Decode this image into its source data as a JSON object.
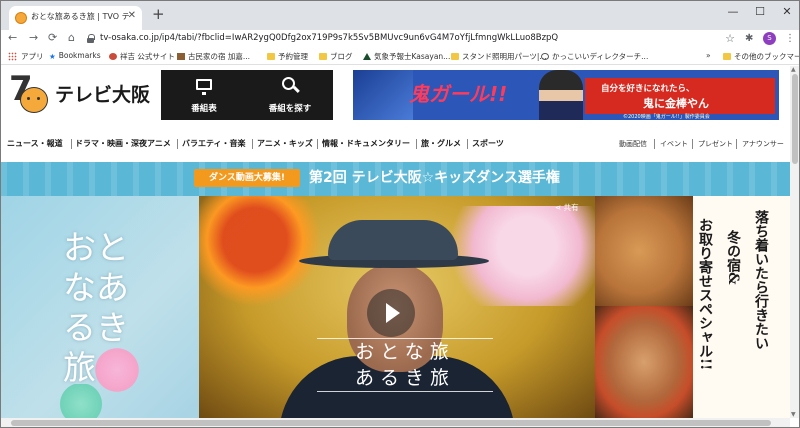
{
  "browser": {
    "tab_title": "おとな旅あるき旅 | TVO テレビ大阪",
    "new_tab": "+",
    "url": "tv-osaka.co.jp/ip4/tabi/?fbclid=IwAR2ygQ0Dfg2ox719P9s7k5Sv5BMUvc9un6vG4M7oYfjLfmngWkLLuo8BzpQ",
    "profile_initial": "S"
  },
  "bookmarks": {
    "items": [
      "アプリ",
      "Bookmarks",
      "祥吉 公式サイト",
      "古民家の宿 加嘉...",
      "予約管理",
      "ブログ",
      "気象予報士Kasayan...",
      "スタンド照明用パーツ|...",
      "かっこいいディレクターチ..."
    ],
    "more": "»",
    "other": "その他のブックマーク"
  },
  "site": {
    "logo_text": "テレビ大阪",
    "logo_mark": "7",
    "nav_boxes": [
      "番組表",
      "番組を探す"
    ],
    "banner": {
      "title": "鬼ガール!!",
      "copy1": "自分を好きになれたら、",
      "copy2": "鬼に金棒やん",
      "credit": "©2020映画「鬼ガール!!」製作委員会"
    },
    "genres": [
      "ニュース・報道",
      "ドラマ・映画・深夜アニメ",
      "バラエティ・音楽",
      "アニメ・キッズ",
      "情報・ドキュメンタリー",
      "旅・グルメ",
      "スポーツ"
    ],
    "util_links": [
      "動画配信",
      "イベント",
      "プレゼント",
      "アナウンサー"
    ],
    "dance": {
      "tag": "ダンス動画大募集!",
      "title": "第2回 テレビ大阪☆キッズダンス選手権"
    },
    "hero": {
      "left_title": "おとなあるき旅",
      "share": "共有",
      "video_line1": "おとな旅",
      "video_line2": "あるき旅",
      "promo_columns": [
        "お取り寄せスペシャル!!",
        "冬の宿&",
        "落ち着いたら行きたい"
      ]
    }
  },
  "colors": {
    "tabstrip": "#dee1e6",
    "dance_band": "#5bb7d6",
    "dance_tag": "#f39a1e",
    "nav_box": "#1a1a1a"
  }
}
